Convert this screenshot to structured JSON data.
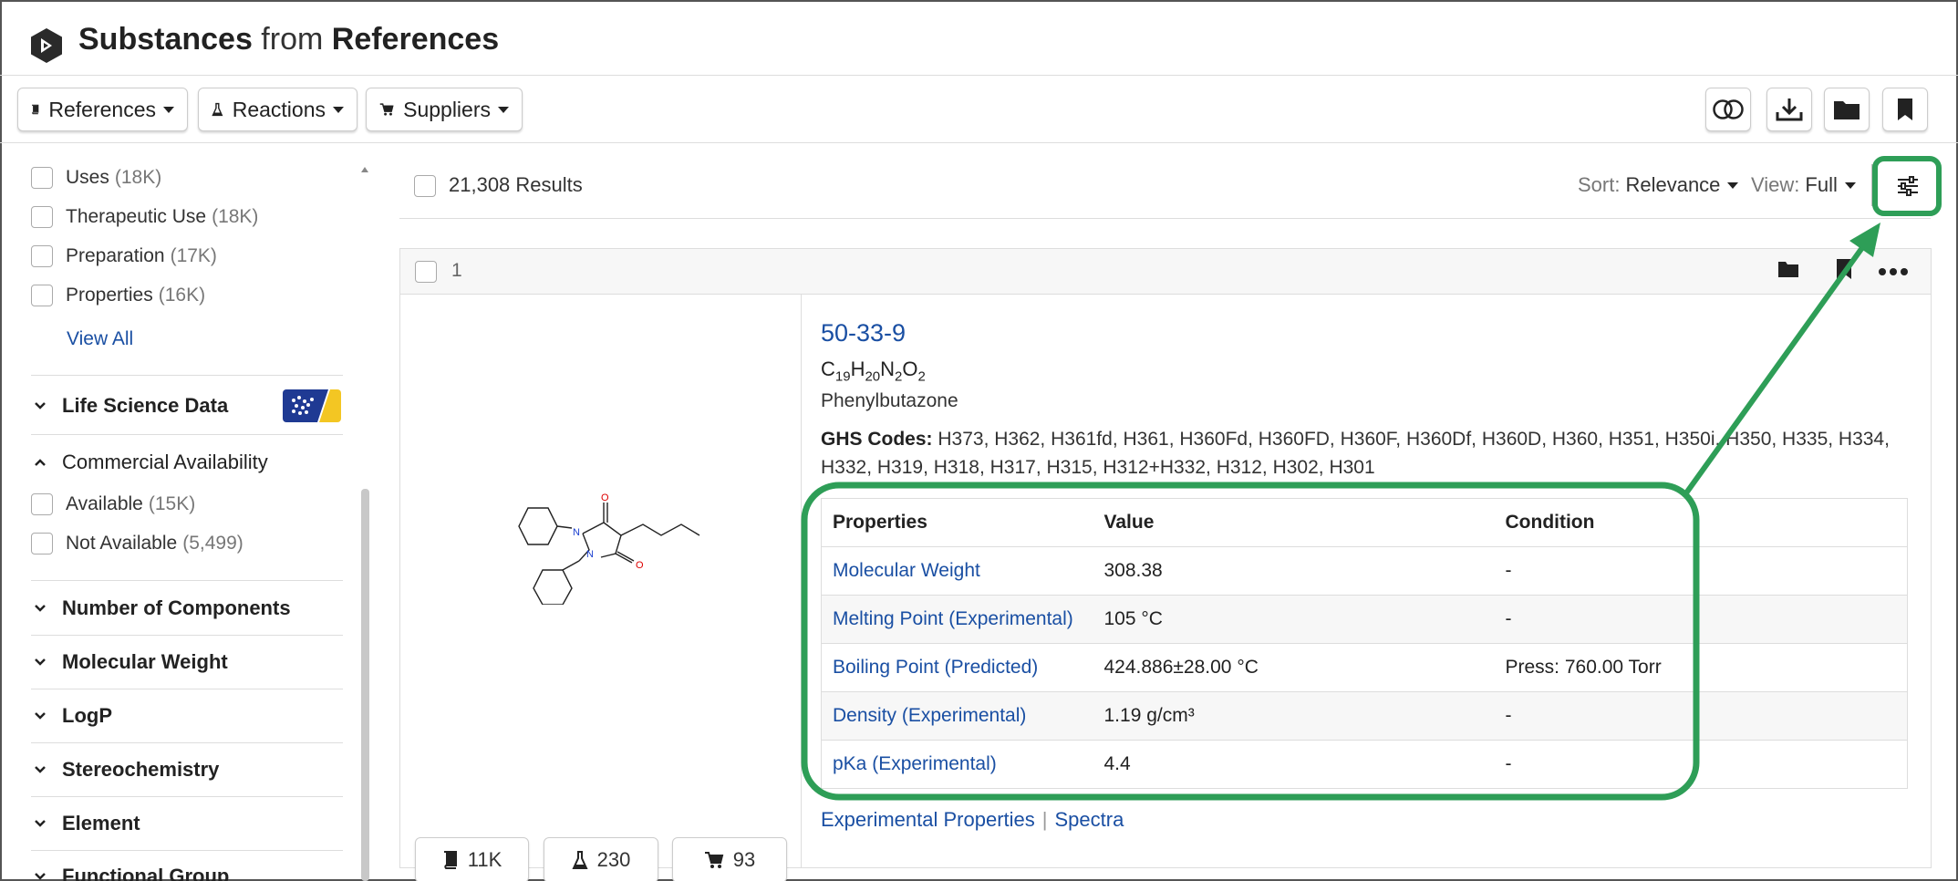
{
  "header": {
    "title_part1": "Substances",
    "title_part2": " from ",
    "title_part3": "References"
  },
  "toolbar": {
    "references_label": "References",
    "reactions_label": "Reactions",
    "suppliers_label": "Suppliers"
  },
  "sidebar": {
    "doc_filters": [
      {
        "label": "Uses",
        "count": "(18K)"
      },
      {
        "label": "Therapeutic Use",
        "count": "(18K)"
      },
      {
        "label": "Preparation",
        "count": "(17K)"
      },
      {
        "label": "Properties",
        "count": "(16K)"
      }
    ],
    "view_all": "View All",
    "life_science": "Life Science Data",
    "commercial": "Commercial Availability",
    "availability": [
      {
        "label": "Available",
        "count": "(15K)"
      },
      {
        "label": "Not Available",
        "count": "(5,499)"
      }
    ],
    "sections": [
      "Number of Components",
      "Molecular Weight",
      "LogP",
      "Stereochemistry",
      "Element",
      "Functional Group"
    ]
  },
  "results": {
    "count_label": "21,308 Results",
    "sort_label": "Sort:",
    "sort_value": "Relevance",
    "view_label": "View:",
    "view_value": "Full"
  },
  "card": {
    "index": "1",
    "cas": "50-33-9",
    "formula": {
      "c": "C",
      "c_n": "19",
      "h": "H",
      "h_n": "20",
      "n": "N",
      "n_n": "2",
      "o": "O",
      "o_n": "2"
    },
    "name": "Phenylbutazone",
    "ghs_label": "GHS Codes:",
    "ghs_codes": "H373, H362, H361fd, H361, H360Fd, H360FD, H360F, H360Df, H360D, H360, H351, H350i, H350, H335, H334, H332, H319, H318, H317, H315, H312+H332, H312, H302, H301",
    "table_headers": [
      "Properties",
      "Value",
      "Condition"
    ],
    "properties": [
      {
        "name": "Molecular Weight",
        "value": "308.38",
        "condition": "-"
      },
      {
        "name": "Melting Point (Experimental)",
        "value": "105 °C",
        "condition": "-"
      },
      {
        "name": "Boiling Point (Predicted)",
        "value": "424.886±28.00 °C",
        "condition": "Press: 760.00 Torr"
      },
      {
        "name": "Density (Experimental)",
        "value": "1.19 g/cm³",
        "condition": "-"
      },
      {
        "name": "pKa (Experimental)",
        "value": "4.4",
        "condition": "-"
      }
    ],
    "stats": {
      "references": "11K",
      "reactions": "230",
      "suppliers": "93"
    },
    "links": {
      "experimental": "Experimental Properties",
      "separator": "|",
      "spectra": "Spectra"
    }
  },
  "colors": {
    "annotation": "#2e9e57",
    "link": "#1a4fa3"
  },
  "structure_atoms": {
    "o": "O",
    "n": "N"
  }
}
